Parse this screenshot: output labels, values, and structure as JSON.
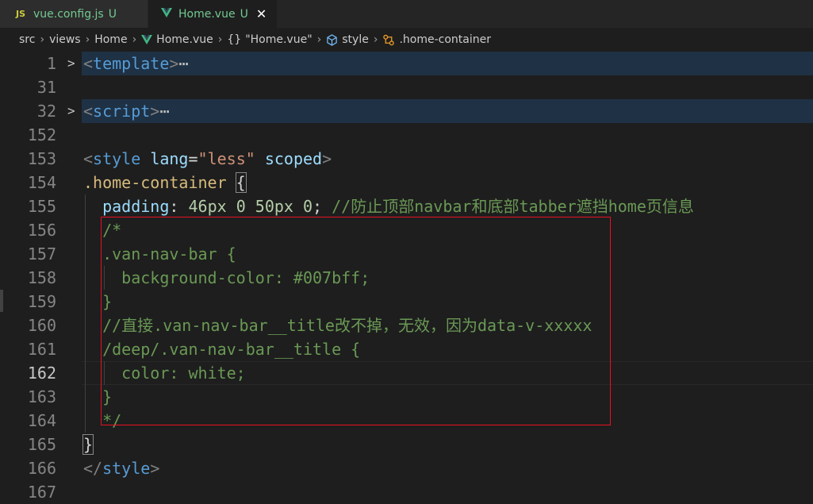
{
  "tabs": [
    {
      "icon": "js-icon",
      "badge": "JS",
      "label": "vue.config.js",
      "status": "U"
    },
    {
      "icon": "vue-icon",
      "label": "Home.vue",
      "status": "U",
      "active": true
    }
  ],
  "breadcrumb": [
    "src",
    "views",
    "Home",
    "Home.vue",
    "\"Home.vue\"",
    "style",
    ".home-container"
  ],
  "breadcrumb_icons": {
    "braces": "{}"
  },
  "lines": {
    "l1": "1",
    "l31": "31",
    "l32": "32",
    "l152": "152",
    "l153": "153",
    "l154": "154",
    "l155": "155",
    "l156": "156",
    "l157": "157",
    "l158": "158",
    "l159": "159",
    "l160": "160",
    "l161": "161",
    "l162": "162",
    "l163": "163",
    "l164": "164",
    "l165": "165",
    "l166": "166",
    "l167": "167"
  },
  "code": {
    "template_open": "<",
    "template": "template",
    "template_close": ">",
    "ellipsis": "⋯",
    "script_open": "<",
    "script": "script",
    "script_close": ">",
    "style_tag": "style",
    "lang_attr": "lang",
    "lang_val": "\"less\"",
    "scoped": "scoped",
    "selector": ".home-container",
    "brace_open": "{",
    "padding_prop": "padding",
    "padding_val": "46px 0 50px 0",
    "padding_comment": "//防止顶部navbar和底部tabber遮挡home页信息",
    "c156": "/*",
    "c157": ".van-nav-bar {",
    "c158": "  background-color: #007bff;",
    "c159": "}",
    "c160": "//直接.van-nav-bar__title改不掉，无效，因为data-v-xxxxx",
    "c161": "/deep/.van-nav-bar__title {",
    "c162": "  color: white;",
    "c163": "}",
    "c164": "*/",
    "brace_close": "}",
    "style_close": "style"
  },
  "colors": {
    "accent_green": "#73c991",
    "highlight_box": "#e81123"
  }
}
